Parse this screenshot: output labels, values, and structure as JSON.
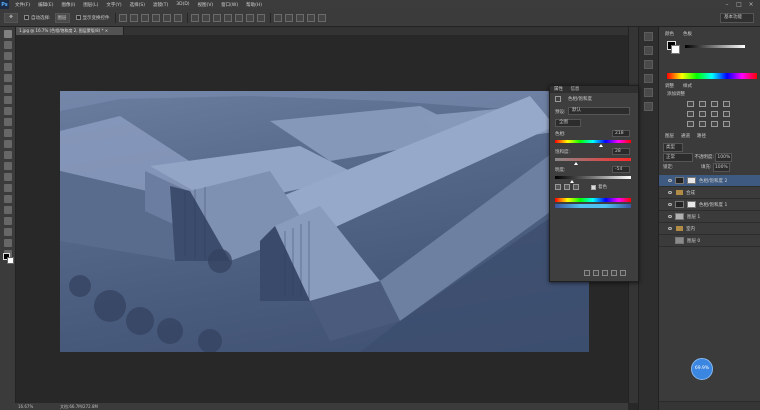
{
  "app": {
    "logo": "Ps"
  },
  "menu": [
    "文件(F)",
    "编辑(E)",
    "图像(I)",
    "图层(L)",
    "文字(Y)",
    "选择(S)",
    "滤镜(T)",
    "3D(D)",
    "视图(V)",
    "窗口(W)",
    "帮助(H)"
  ],
  "window_controls": [
    "–",
    "□",
    "×"
  ],
  "options": {
    "auto_select_label": "自动选择:",
    "auto_select_value": "图层",
    "show_transform_label": "显示变换控件",
    "workspace": "基本功能"
  },
  "document": {
    "tab_title": "1.jpg @ 16.7% (色相/饱和度 2, 图层蒙版/8) * ×",
    "zoom": "16.67%",
    "doc_size": "文档:66.7M/272.8M"
  },
  "panels": {
    "color_tabs": [
      "颜色",
      "色板"
    ],
    "adjust_tabs": [
      "调整",
      "样式"
    ],
    "adjust_title": "添加调整",
    "layers_tabs": [
      "图层",
      "通道",
      "路径"
    ],
    "kind_label": "类型",
    "blend_mode": "正常",
    "opacity_label": "不透明度:",
    "opacity_value": "100%",
    "lock_label": "锁定:",
    "fill_label": "填充:",
    "fill_value": "100%"
  },
  "layers": [
    {
      "name": "色相/饱和度 2",
      "type": "adjust",
      "active": true
    },
    {
      "name": "合成",
      "type": "folder",
      "active": false
    },
    {
      "name": "色相/饱和度 1",
      "type": "adjust",
      "active": false
    },
    {
      "name": "图层 1",
      "type": "image",
      "active": false
    },
    {
      "name": "室内",
      "type": "folder",
      "active": false
    },
    {
      "name": "图层 0",
      "type": "image",
      "active": false
    }
  ],
  "properties": {
    "tabs": [
      "属性",
      "信息"
    ],
    "title": "色相/饱和度",
    "preset_label": "预设:",
    "preset_value": "默认",
    "channel": "全图",
    "hue_label": "色相:",
    "hue": 218,
    "saturation_label": "饱和度:",
    "saturation": 28,
    "lightness_label": "明度:",
    "lightness": -54,
    "colorize_label": "着色",
    "colorize": true
  },
  "badge_text": "69.9%"
}
